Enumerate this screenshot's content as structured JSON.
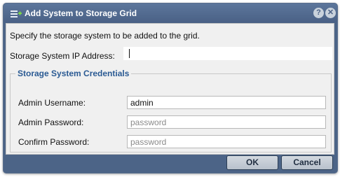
{
  "dialog": {
    "title": "Add System to Storage Grid",
    "icon": "add-system-icon",
    "help_glyph": "?",
    "close_glyph": "✕"
  },
  "form": {
    "intro": "Specify the storage system to be added to the grid.",
    "ip_label": "Storage System IP Address:",
    "ip_value": "",
    "credentials_legend": "Storage System Credentials",
    "username_label": "Admin Username:",
    "username_value": "admin",
    "password_label": "Admin Password:",
    "password_placeholder": "password",
    "confirm_label": "Confirm Password:",
    "confirm_placeholder": "password"
  },
  "buttons": {
    "ok": "OK",
    "cancel": "Cancel"
  },
  "colors": {
    "titlebar": "#4a6186",
    "legend": "#2a5a93"
  }
}
